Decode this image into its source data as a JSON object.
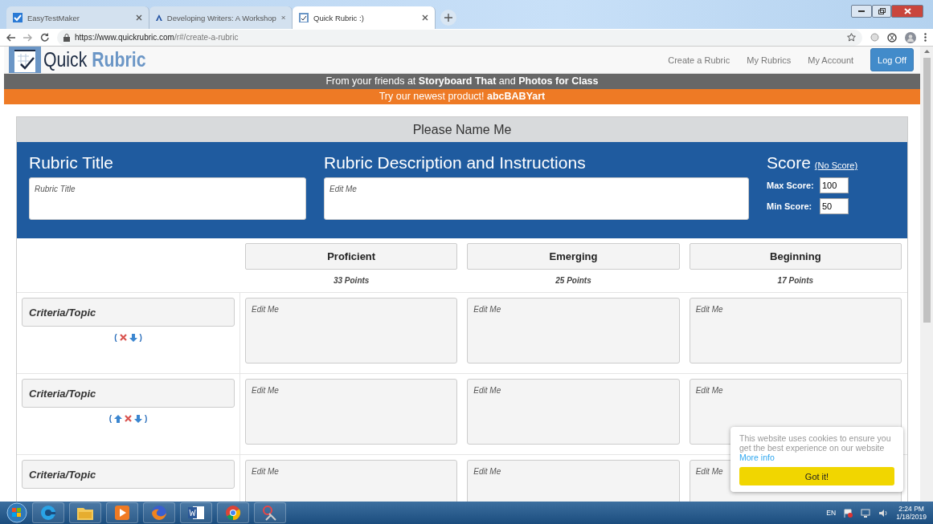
{
  "browser": {
    "tabs": [
      {
        "title": "EasyTestMaker",
        "selected": false
      },
      {
        "title": "Developing Writers: A Workshop",
        "selected": false
      },
      {
        "title": "Quick Rubric :)",
        "selected": true
      }
    ],
    "url_host": "https://www.quickrubric.com",
    "url_path": "/r#/create-a-rubric"
  },
  "nav": {
    "logo_first": "Quick",
    "logo_second": "Rubric",
    "links": [
      "Create a Rubric",
      "My Rubrics",
      "My Account"
    ],
    "button": "Log Off"
  },
  "banners": [
    {
      "kind": "gray",
      "text": "From your friends at **Storyboard That** and **Photos for Class**"
    },
    {
      "kind": "orange",
      "text": "Try our newest product! **abcBABYart**"
    }
  ],
  "rubric": {
    "name": "Please Name Me",
    "title_label": "Rubric Title",
    "title_placeholder": "Rubric Title",
    "description_label": "Rubric Description and Instructions",
    "description_placeholder": "Edit Me",
    "score_label": "Score",
    "no_score_link": "(No Score)",
    "max_label": "Max Score:",
    "max_value": "100",
    "min_label": "Min Score:",
    "min_value": "50"
  },
  "columns": [
    {
      "name": "Proficient",
      "points": "33 Points"
    },
    {
      "name": "Emerging",
      "points": "25 Points"
    },
    {
      "name": "Beginning",
      "points": "17 Points"
    }
  ],
  "rows": [
    {
      "criteria": "Criteria/Topic",
      "bracket_open": "(",
      "bracket_close": ")",
      "controls": [
        {
          "kind": "delete"
        },
        {
          "kind": "down"
        }
      ],
      "cells": [
        {
          "placeholder": "Edit Me"
        },
        {
          "placeholder": "Edit Me"
        },
        {
          "placeholder": "Edit Me"
        }
      ]
    },
    {
      "criteria": "Criteria/Topic",
      "bracket_open": "(",
      "bracket_close": ")",
      "controls": [
        {
          "kind": "up"
        },
        {
          "kind": "delete"
        },
        {
          "kind": "down"
        }
      ],
      "cells": [
        {
          "placeholder": "Edit Me"
        },
        {
          "placeholder": "Edit Me"
        },
        {
          "placeholder": "Edit Me"
        }
      ]
    },
    {
      "criteria": "Criteria/Topic",
      "cells": [
        {
          "placeholder": "Edit Me"
        },
        {
          "placeholder": "Edit Me"
        },
        {
          "placeholder": "Edit Me"
        }
      ]
    }
  ],
  "cookie": {
    "text": "This website uses cookies to ensure you get the best experience on our website",
    "link": "More info",
    "button": "Got it!"
  },
  "taskbar": {
    "apps": [
      {
        "kind": "ie"
      },
      {
        "kind": "folder"
      },
      {
        "kind": "media"
      },
      {
        "kind": "firefox"
      },
      {
        "kind": "word"
      },
      {
        "kind": "chrome"
      },
      {
        "kind": "snip"
      }
    ],
    "language": "EN",
    "time": "2:24 PM",
    "date": "1/18/2019"
  }
}
